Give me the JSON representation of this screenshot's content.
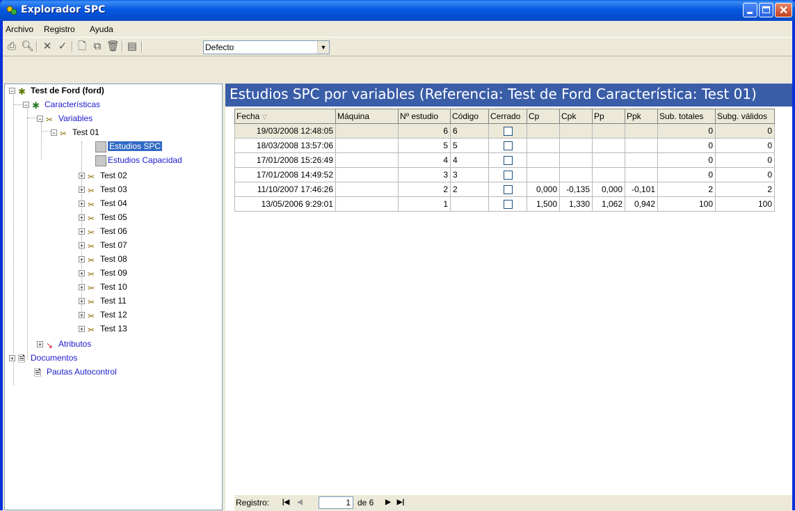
{
  "window": {
    "title": "Explorador SPC"
  },
  "menu": [
    {
      "label": "Archivo"
    },
    {
      "label": "Registro"
    },
    {
      "label": "Ayuda"
    }
  ],
  "toolbar": {
    "combo_value": "Defecto"
  },
  "tree": {
    "root": "Test de Ford (ford)",
    "caracteristicas": "Características",
    "variables": "Variables",
    "test01": "Test 01",
    "estudios_spc": "Estudios SPC",
    "estudios_capacidad": "Estudios Capacidad",
    "tests": [
      "Test 02",
      "Test 03",
      "Test 04",
      "Test 05",
      "Test 06",
      "Test 07",
      "Test 08",
      "Test 09",
      "Test 10",
      "Test 11",
      "Test 12",
      "Test 13"
    ],
    "atributos": "Atributos",
    "documentos": "Documentos",
    "pautas": "Pautas Autocontrol"
  },
  "main": {
    "header": "Estudios SPC por variables (Referencia: Test de Ford Característica: Test 01)",
    "columns": [
      "Fecha",
      "Máquina",
      "Nº estudio",
      "Código",
      "Cerrado",
      "Cp",
      "Cpk",
      "Pp",
      "Ppk",
      "Sub. totales",
      "Subg. válidos"
    ],
    "rows": [
      [
        "19/03/2008 12:48:05",
        "",
        "6",
        "6",
        "",
        "",
        "",
        "",
        "",
        "0",
        "0"
      ],
      [
        "18/03/2008 13:57:06",
        "",
        "5",
        "5",
        "",
        "",
        "",
        "",
        "",
        "0",
        "0"
      ],
      [
        "17/01/2008 15:26:49",
        "",
        "4",
        "4",
        "",
        "",
        "",
        "",
        "",
        "0",
        "0"
      ],
      [
        "17/01/2008 14:49:52",
        "",
        "3",
        "3",
        "",
        "",
        "",
        "",
        "",
        "0",
        "0"
      ],
      [
        "11/10/2007 17:46:26",
        "",
        "2",
        "2",
        "",
        "0,000",
        "-0,135",
        "0,000",
        "-0,101",
        "2",
        "2"
      ],
      [
        "13/05/2006 9:29:01",
        "",
        "1",
        "",
        "",
        "1,500",
        "1,330",
        "1,062",
        "0,942",
        "100",
        "100"
      ]
    ]
  },
  "navigator": {
    "label": "Registro:",
    "current": "1",
    "of_text": "de 6"
  }
}
